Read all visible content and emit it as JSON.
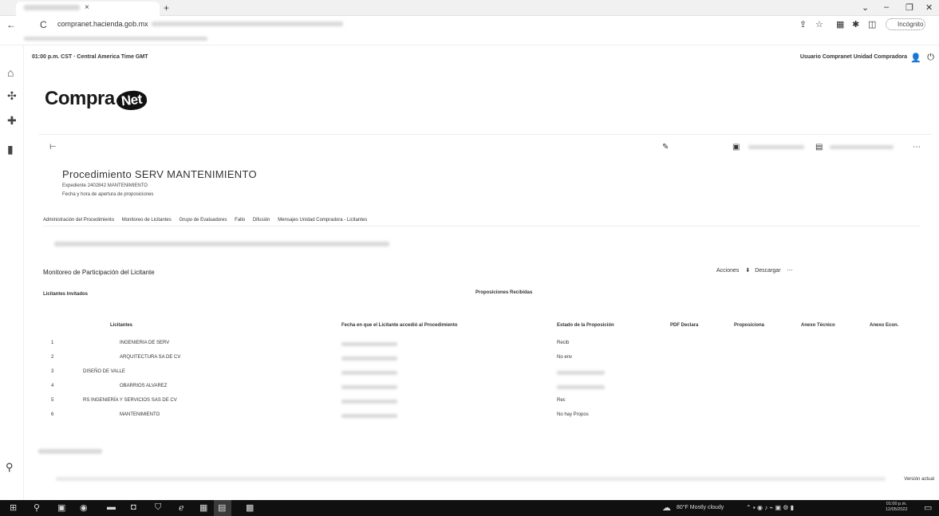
{
  "browser": {
    "tab_close": "×",
    "new_tab": "+",
    "window_controls": [
      "⌄",
      "–",
      "❐",
      "✕"
    ],
    "nav_back": "←",
    "nav_reload": "C",
    "url": "compranet.hacienda.gob.mx",
    "profile_label": "Incógnito"
  },
  "app": {
    "time_line": "01:00 p.m. CST · Central America Time GMT",
    "user_line": "Usuario Compranet Unidad Compradora",
    "logo_text": "Compra",
    "logo_badge": "Net"
  },
  "procedure": {
    "title": "Procedimiento   SERV   MANTENIMIENTO",
    "sub1": "Expediente 2402842   MANTENIMIENTO",
    "sub2": "Fecha y hora de apertura de proposiciones"
  },
  "tabs": [
    "Administración del Procedimiento",
    "Monitoreo de Licitantes",
    "Grupo de Evaluadores",
    "Fallo",
    "Difusión",
    "Mensajes Unidad Compradora - Licitantes"
  ],
  "section": {
    "title": "Monitoreo de Participación del Licitante",
    "actions": [
      "Acciones",
      "Descargar"
    ],
    "left_label": "Licitantes Invitados",
    "right_label": "Proposiciones Recibidas"
  },
  "table": {
    "headers": [
      "Licitantes",
      "Fecha en que el Licitante accedió al Procedimiento",
      "Estado de la Proposición",
      "PDF Declara",
      "Proposiciona",
      "Anexo Técnico",
      "Anexo Econ."
    ],
    "rows": [
      {
        "num": "1",
        "name": "INGENIERIA DE SERV",
        "date": "",
        "status": "Recib"
      },
      {
        "num": "2",
        "name": "ARQUITECTURA SA DE CV",
        "date": "",
        "status": "No env"
      },
      {
        "num": "3",
        "name": "DISEÑO DE VALLE",
        "date": "",
        "status": ""
      },
      {
        "num": "4",
        "name": "OBARRIOS ALVAREZ",
        "date": "",
        "status": ""
      },
      {
        "num": "5",
        "name": "RS INGENIERÍA Y SERVICIOS SAS DE CV",
        "date": "",
        "status": "Rec"
      },
      {
        "num": "6",
        "name": "MANTENIMIENTO",
        "date": "",
        "status": "No hay Propos"
      }
    ]
  },
  "footer": {
    "version": "Versión actual"
  },
  "taskbar": {
    "weather": "80°F  Mostly cloudy",
    "time": "01:00 p.m.",
    "date": "12/05/2022"
  }
}
